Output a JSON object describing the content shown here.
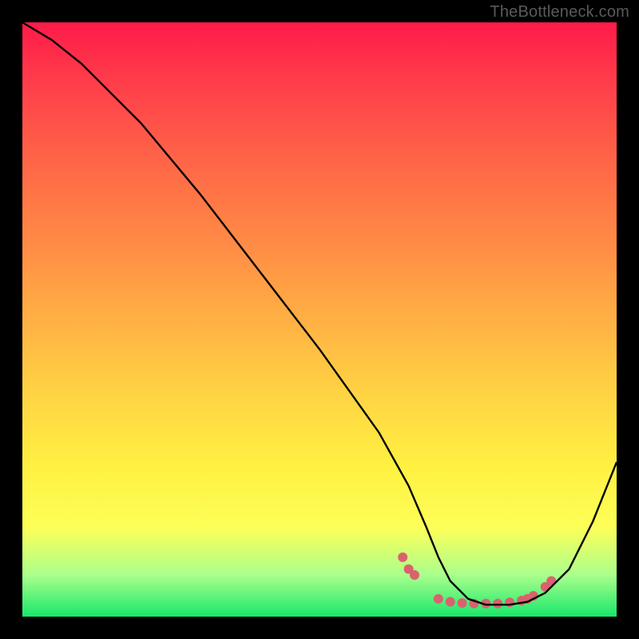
{
  "watermark": "TheBottleneck.com",
  "chart_data": {
    "type": "line",
    "title": "",
    "xlabel": "",
    "ylabel": "",
    "xlim": [
      0,
      100
    ],
    "ylim": [
      0,
      100
    ],
    "series": [
      {
        "name": "curve",
        "x": [
          0,
          5,
          10,
          20,
          30,
          40,
          50,
          60,
          65,
          68,
          70,
          72,
          75,
          78,
          80,
          82,
          85,
          88,
          92,
          96,
          100
        ],
        "y": [
          100,
          97,
          93,
          83,
          71,
          58,
          45,
          31,
          22,
          15,
          10,
          6,
          3,
          2,
          2,
          2,
          2.5,
          4,
          8,
          16,
          26
        ]
      }
    ],
    "markers": [
      {
        "x": 64,
        "y": 10
      },
      {
        "x": 65,
        "y": 8
      },
      {
        "x": 66,
        "y": 7
      },
      {
        "x": 70,
        "y": 3
      },
      {
        "x": 72,
        "y": 2.5
      },
      {
        "x": 74,
        "y": 2.3
      },
      {
        "x": 76,
        "y": 2.2
      },
      {
        "x": 78,
        "y": 2.2
      },
      {
        "x": 80,
        "y": 2.2
      },
      {
        "x": 82,
        "y": 2.4
      },
      {
        "x": 84,
        "y": 2.7
      },
      {
        "x": 85,
        "y": 3
      },
      {
        "x": 86,
        "y": 3.5
      },
      {
        "x": 88,
        "y": 5
      },
      {
        "x": 89,
        "y": 6
      }
    ],
    "colors": {
      "curve": "#000000",
      "markers": "#d9626e",
      "gradient_top": "#ff1a4a",
      "gradient_bottom": "#17e86a"
    }
  }
}
